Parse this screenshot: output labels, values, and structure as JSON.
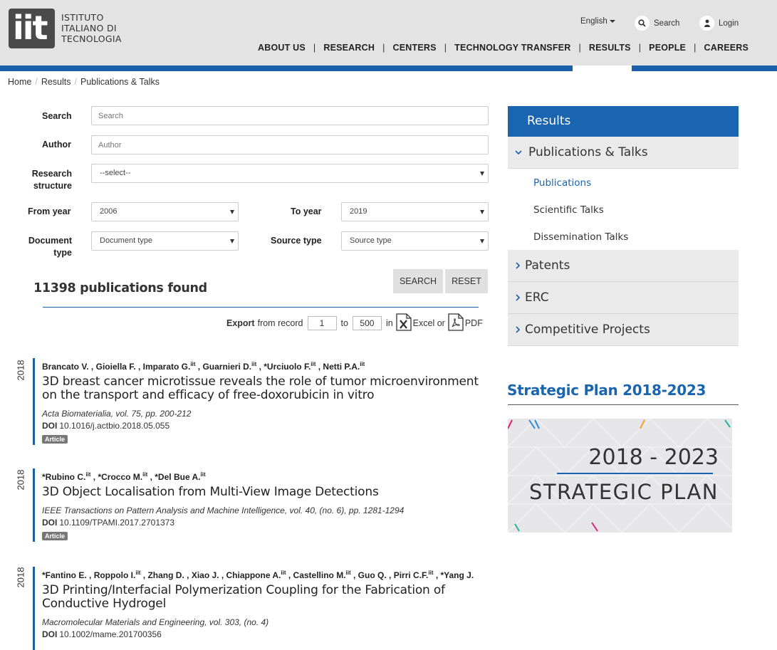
{
  "header": {
    "logo_mark": "iit",
    "logo_lines": [
      "ISTITUTO",
      "ITALIANO DI",
      "TECNOLOGIA"
    ],
    "language": "English",
    "search_label": "Search",
    "login_label": "Login",
    "nav": [
      "ABOUT US",
      "RESEARCH",
      "CENTERS",
      "TECHNOLOGY TRANSFER",
      "RESULTS",
      "PEOPLE",
      "CAREERS"
    ],
    "nav_separator": "|",
    "brand_color": "#1a5fa8"
  },
  "breadcrumb": [
    "Home",
    "Results",
    "Publications & Talks"
  ],
  "form": {
    "search_label": "Search",
    "search_placeholder": "Search",
    "author_label": "Author",
    "author_placeholder": "Author",
    "research_label_1": "Research",
    "research_label_2": "structure",
    "research_value": "--select--",
    "from_year_label": "From year",
    "from_year_value": "2006",
    "to_year_label": "To year",
    "to_year_value": "2019",
    "doc_type_label_1": "Document",
    "doc_type_label_2": "type",
    "doc_type_value": "Document type",
    "source_type_label": "Source type",
    "source_type_value": "Source type",
    "search_button": "SEARCH",
    "reset_button": "RESET"
  },
  "results": {
    "found_text": "11398 publications found",
    "export_label": "Export",
    "from_record": "from record",
    "record_from": "1",
    "to": "to",
    "record_to": "500",
    "in": "in",
    "excel": "Excel or",
    "pdf": "PDF"
  },
  "publications": [
    {
      "year": "2018",
      "authors": [
        {
          "name": "Brancato V.",
          "iit": false
        },
        {
          "name": "Gioiella F.",
          "iit": false
        },
        {
          "name": "Imparato G.",
          "iit": true
        },
        {
          "name": "Guarnieri D.",
          "iit": true
        },
        {
          "name": "*Urciuolo F.",
          "iit": true
        },
        {
          "name": "Netti P.A.",
          "iit": true
        }
      ],
      "title": "3D breast cancer microtissue reveals the role of tumor microenvironment on the transport and efficacy of free-doxorubicin in vitro",
      "journal": "Acta Biomaterialia, vol. 75, pp. 200-212",
      "doi_label": "DOI",
      "doi": "10.1016/j.actbio.2018.05.055",
      "type": "Article"
    },
    {
      "year": "2018",
      "authors": [
        {
          "name": "*Rubino C.",
          "iit": true
        },
        {
          "name": "*Crocco M.",
          "iit": true
        },
        {
          "name": "*Del Bue A.",
          "iit": true
        }
      ],
      "title": "3D Object Localisation from Multi-View Image Detections",
      "journal": "IEEE Transactions on Pattern Analysis and Machine Intelligence, vol. 40, (no. 6), pp. 1281-1294",
      "doi_label": "DOI",
      "doi": "10.1109/TPAMI.2017.2701373",
      "type": "Article"
    },
    {
      "year": "2018",
      "authors": [
        {
          "name": "*Fantino E.",
          "iit": false
        },
        {
          "name": "Roppolo I.",
          "iit": true
        },
        {
          "name": "Zhang D.",
          "iit": false
        },
        {
          "name": "Xiao J.",
          "iit": false
        },
        {
          "name": "Chiappone A.",
          "iit": true
        },
        {
          "name": "Castellino M.",
          "iit": true
        },
        {
          "name": "Guo Q.",
          "iit": false
        },
        {
          "name": "Pirri C.F.",
          "iit": true
        },
        {
          "name": "*Yang J.",
          "iit": false
        }
      ],
      "title": "3D Printing/Interfacial Polymerization Coupling for the Fabrication of Conductive Hydrogel",
      "journal": "Macromolecular Materials and Engineering, vol. 303, (no. 4)",
      "doi_label": "DOI",
      "doi": "10.1002/mame.201700356",
      "type": ""
    }
  ],
  "iit_sup": "iit",
  "sidebar": {
    "header": "Results",
    "sections": [
      {
        "label": "Publications & Talks",
        "expanded": true,
        "children": [
          "Publications",
          "Scientific Talks",
          "Dissemination Talks"
        ]
      },
      {
        "label": "Patents",
        "expanded": false
      },
      {
        "label": "ERC",
        "expanded": false
      },
      {
        "label": "Competitive Projects",
        "expanded": false
      }
    ],
    "strategic_title": "Strategic Plan 2018-2023",
    "strategic_years": "2018 - 2023",
    "strategic_caption": "STRATEGIC PLAN"
  }
}
